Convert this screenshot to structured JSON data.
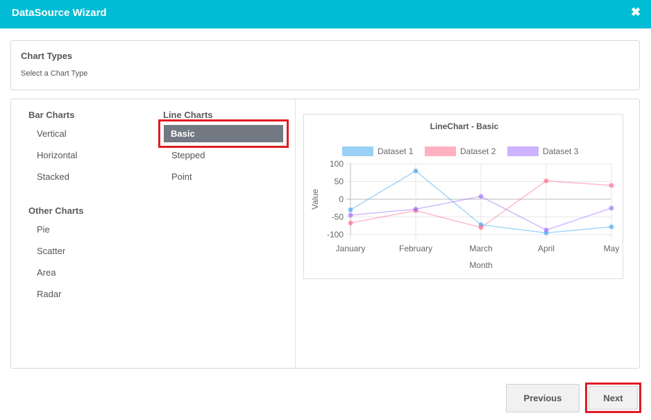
{
  "window": {
    "title": "DataSource Wizard",
    "close_icon": "close-icon"
  },
  "header_panel": {
    "title": "Chart Types",
    "subtitle": "Select a Chart Type"
  },
  "groups": {
    "bar": {
      "label": "Bar Charts",
      "items": [
        "Vertical",
        "Horizontal",
        "Stacked"
      ]
    },
    "line": {
      "label": "Line Charts",
      "items": [
        "Basic",
        "Stepped",
        "Point"
      ],
      "selected": "Basic"
    },
    "other": {
      "label": "Other Charts",
      "items": [
        "Pie",
        "Scatter",
        "Area",
        "Radar"
      ]
    }
  },
  "buttons": {
    "previous": "Previous",
    "next": "Next"
  },
  "colors": {
    "titlebar": "#00bcd4",
    "selection": "#737983",
    "highlight": "#e01b24"
  },
  "chart_data": {
    "type": "line",
    "title": "LineChart - Basic",
    "xlabel": "Month",
    "ylabel": "Value",
    "categories": [
      "January",
      "February",
      "March",
      "April",
      "May"
    ],
    "ylim": [
      -100,
      100
    ],
    "yticks": [
      100,
      50,
      0,
      -50,
      -100
    ],
    "grid": true,
    "legend": "top",
    "series": [
      {
        "name": "Dataset 1",
        "values": [
          -30,
          80,
          -72,
          -95,
          -78
        ],
        "color": "#36a2eb"
      },
      {
        "name": "Dataset 2",
        "values": [
          -67,
          -32,
          -80,
          52,
          39
        ],
        "color": "#ff6384"
      },
      {
        "name": "Dataset 3",
        "values": [
          -45,
          -28,
          8,
          -87,
          -25
        ],
        "color": "#9966ff"
      }
    ]
  }
}
